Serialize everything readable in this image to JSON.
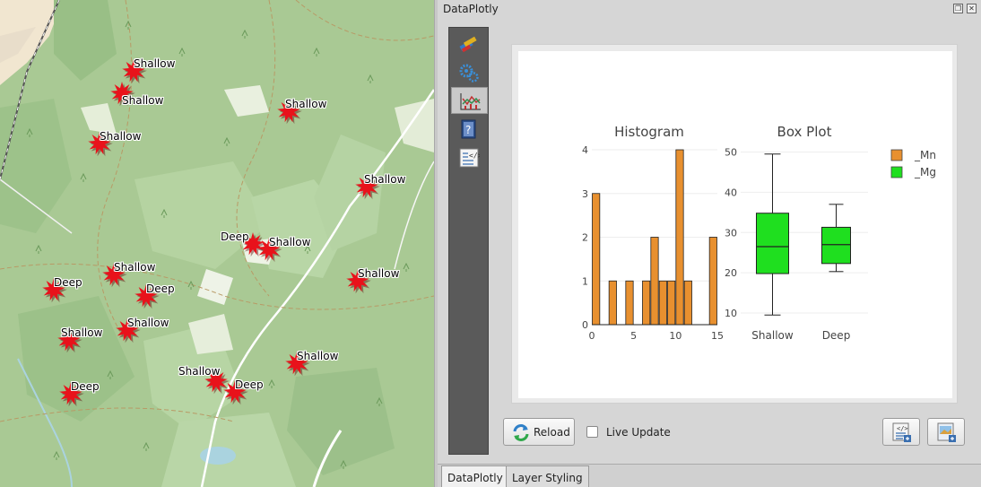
{
  "panel": {
    "title": "DataPlotly",
    "float_icon": "float-icon",
    "close_icon": "close-icon"
  },
  "sidebar": {
    "items": [
      {
        "name": "properties",
        "icon": "paint-brush-icon"
      },
      {
        "name": "settings",
        "icon": "gears-icon"
      },
      {
        "name": "plot",
        "icon": "line-chart-icon",
        "active": true
      },
      {
        "name": "help",
        "icon": "help-book-icon"
      },
      {
        "name": "raw-html",
        "icon": "html-code-icon"
      }
    ]
  },
  "controls": {
    "reload_label": "Reload",
    "live_update_label": "Live Update",
    "live_update_checked": false
  },
  "tabs": [
    {
      "label": "DataPlotly",
      "active": true
    },
    {
      "label": "Layer Styling",
      "active": false
    }
  ],
  "map": {
    "markers": [
      {
        "label": "Shallow"
      },
      {
        "label": "Shallow"
      },
      {
        "label": "Shallow"
      },
      {
        "label": "Shallow"
      },
      {
        "label": "Shallow"
      },
      {
        "label": "Deep"
      },
      {
        "label": "Shallow"
      },
      {
        "label": "Shallow"
      },
      {
        "label": "Shallow"
      },
      {
        "label": "Deep"
      },
      {
        "label": "Deep"
      },
      {
        "label": "Shallow"
      },
      {
        "label": "Shallow"
      },
      {
        "label": "Shallow"
      },
      {
        "label": "Deep"
      },
      {
        "label": "Shallow"
      },
      {
        "label": "Deep"
      }
    ],
    "colors": {
      "marker": "#e8121b",
      "terrain": "#a9c994",
      "forest": "#8fb87e"
    }
  },
  "chart_data": [
    {
      "type": "bar",
      "title": "Histogram",
      "bin_width": 1,
      "bins": [
        {
          "start": 0,
          "count": 3
        },
        {
          "start": 1,
          "count": 0
        },
        {
          "start": 2,
          "count": 1
        },
        {
          "start": 3,
          "count": 0
        },
        {
          "start": 4,
          "count": 1
        },
        {
          "start": 5,
          "count": 0
        },
        {
          "start": 6,
          "count": 1
        },
        {
          "start": 7,
          "count": 2
        },
        {
          "start": 8,
          "count": 1
        },
        {
          "start": 9,
          "count": 1
        },
        {
          "start": 10,
          "count": 4
        },
        {
          "start": 11,
          "count": 1
        },
        {
          "start": 12,
          "count": 0
        },
        {
          "start": 13,
          "count": 0
        },
        {
          "start": 14,
          "count": 2
        }
      ],
      "xlim": [
        0,
        15
      ],
      "ylim": [
        0,
        4
      ],
      "xticks": [
        "0",
        "5",
        "10",
        "15"
      ],
      "yticks": [
        "0",
        "1",
        "2",
        "3",
        "4"
      ],
      "color": "#e8902f",
      "series_name": "_Mn"
    },
    {
      "type": "box",
      "title": "Box Plot",
      "categories": [
        "Shallow",
        "Deep"
      ],
      "boxes": [
        {
          "min": 9.5,
          "q1": 19.8,
          "median": 26.5,
          "q3": 34.8,
          "max": 49.5
        },
        {
          "min": 20.3,
          "q1": 22.3,
          "median": 27.0,
          "q3": 31.3,
          "max": 37.0
        }
      ],
      "ylim": [
        8,
        51
      ],
      "yticks": [
        "10",
        "20",
        "30",
        "40",
        "50"
      ],
      "color": "#1fdf1f",
      "series_name": "_Mg"
    }
  ],
  "legend": {
    "placement": "top-right",
    "items": [
      {
        "name": "_Mn",
        "color": "#e8902f"
      },
      {
        "name": "_Mg",
        "color": "#1fdf1f"
      }
    ]
  }
}
